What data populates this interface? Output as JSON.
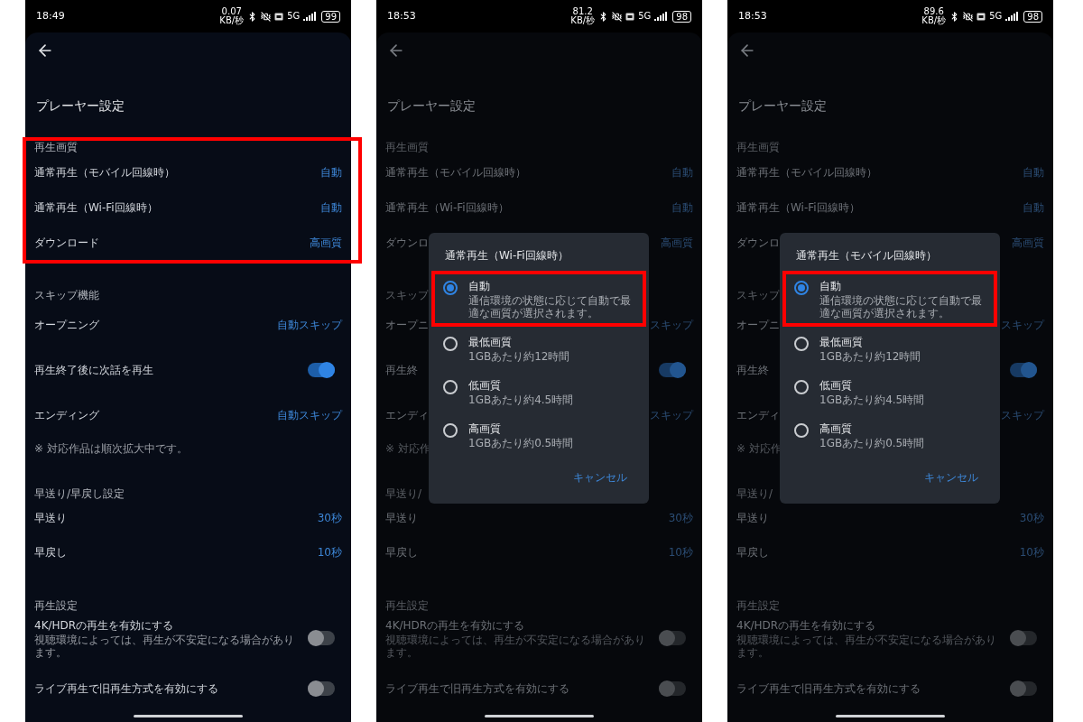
{
  "screens": [
    {
      "status_bar": {
        "time": "18:49",
        "net_speed": "0.07",
        "net_unit": "KB/秒",
        "network": "5G",
        "battery": "99"
      },
      "dimmed": false,
      "title": "プレーヤー設定",
      "sections": [
        {
          "heading": "再生画質",
          "highlight": true,
          "rows": [
            {
              "kind": "value",
              "label": "通常再生（モバイル回線時）",
              "value": "自動"
            },
            {
              "kind": "value",
              "label": "通常再生（Wi-Fi回線時）",
              "value": "自動"
            },
            {
              "kind": "value",
              "label": "ダウンロード",
              "value": "高画質"
            }
          ]
        },
        {
          "heading": "スキップ機能",
          "highlight": false,
          "rows": [
            {
              "kind": "value",
              "label": "オープニング",
              "value": "自動スキップ"
            },
            {
              "kind": "toggle",
              "label": "再生終了後に次話を再生",
              "on": true
            },
            {
              "kind": "value",
              "label": "エンディング",
              "value": "自動スキップ"
            },
            {
              "kind": "note",
              "label": "※ 対応作品は順次拡大中です。"
            }
          ]
        },
        {
          "heading": "早送り/早戻し設定",
          "highlight": false,
          "rows": [
            {
              "kind": "value",
              "label": "早送り",
              "value": "30秒"
            },
            {
              "kind": "value",
              "label": "早戻し",
              "value": "10秒"
            }
          ]
        },
        {
          "heading": "再生設定",
          "highlight": false,
          "rows": [
            {
              "kind": "toggle",
              "label": "4K/HDRの再生を有効にする",
              "sub": "視聴環境によっては、再生が不安定になる場合があります。",
              "on": false
            },
            {
              "kind": "toggle",
              "label": "ライブ再生で旧再生方式を有効にする",
              "on": false
            }
          ]
        }
      ]
    },
    {
      "status_bar": {
        "time": "18:53",
        "net_speed": "81.2",
        "net_unit": "KB/秒",
        "network": "5G",
        "battery": "98"
      },
      "dimmed": true,
      "title": "プレーヤー設定",
      "sections": [
        {
          "heading": "再生画質",
          "highlight": false,
          "rows": [
            {
              "kind": "value",
              "label": "通常再生（モバイル回線時）",
              "value": "自動"
            },
            {
              "kind": "value",
              "label": "通常再生（Wi-Fi回線時）",
              "value": "自動"
            },
            {
              "kind": "value",
              "label": "ダウンロ",
              "value": "高画質"
            }
          ]
        },
        {
          "heading": "スキップ",
          "highlight": false,
          "rows": [
            {
              "kind": "value",
              "label": "オープニ",
              "value": "スキップ"
            },
            {
              "kind": "toggle",
              "label": "再生終",
              "on": true
            },
            {
              "kind": "value",
              "label": "エンディ",
              "value": "スキップ"
            },
            {
              "kind": "note",
              "label": "※ 対応作"
            }
          ]
        },
        {
          "heading": "早送り/",
          "highlight": false,
          "rows": [
            {
              "kind": "value",
              "label": "早送り",
              "value": "30秒"
            },
            {
              "kind": "value",
              "label": "早戻し",
              "value": "10秒"
            }
          ]
        },
        {
          "heading": "再生設定",
          "highlight": false,
          "rows": [
            {
              "kind": "toggle",
              "label": "4K/HDRの再生を有効にする",
              "sub": "視聴環境によっては、再生が不安定になる場合があります。",
              "on": false
            },
            {
              "kind": "toggle",
              "label": "ライブ再生で旧再生方式を有効にする",
              "on": false
            }
          ]
        }
      ],
      "dialog": {
        "title": "通常再生（Wi-Fi回線時）",
        "cancel": "キャンセル",
        "options": [
          {
            "label": "自動",
            "sub": "通信環境の状態に応じて自動で最適な画質が選択されます。",
            "selected": true,
            "highlight": true
          },
          {
            "label": "最低画質",
            "sub": "1GBあたり約12時間",
            "selected": false,
            "highlight": false
          },
          {
            "label": "低画質",
            "sub": "1GBあたり約4.5時間",
            "selected": false,
            "highlight": false
          },
          {
            "label": "高画質",
            "sub": "1GBあたり約0.5時間",
            "selected": false,
            "highlight": false
          }
        ]
      }
    },
    {
      "status_bar": {
        "time": "18:53",
        "net_speed": "89.6",
        "net_unit": "KB/秒",
        "network": "5G",
        "battery": "98"
      },
      "dimmed": true,
      "title": "プレーヤー設定",
      "sections": [
        {
          "heading": "再生画質",
          "highlight": false,
          "rows": [
            {
              "kind": "value",
              "label": "通常再生（モバイル回線時）",
              "value": "自動"
            },
            {
              "kind": "value",
              "label": "通常再生（Wi-Fi回線時）",
              "value": "自動"
            },
            {
              "kind": "value",
              "label": "ダウンロ",
              "value": "高画質"
            }
          ]
        },
        {
          "heading": "スキップ",
          "highlight": false,
          "rows": [
            {
              "kind": "value",
              "label": "オープニ",
              "value": "スキップ"
            },
            {
              "kind": "toggle",
              "label": "再生終",
              "on": true
            },
            {
              "kind": "value",
              "label": "エンディ",
              "value": "スキップ"
            },
            {
              "kind": "note",
              "label": "※ 対応作"
            }
          ]
        },
        {
          "heading": "早送り/",
          "highlight": false,
          "rows": [
            {
              "kind": "value",
              "label": "早送り",
              "value": "30秒"
            },
            {
              "kind": "value",
              "label": "早戻し",
              "value": "10秒"
            }
          ]
        },
        {
          "heading": "再生設定",
          "highlight": false,
          "rows": [
            {
              "kind": "toggle",
              "label": "4K/HDRの再生を有効にする",
              "sub": "視聴環境によっては、再生が不安定になる場合があります。",
              "on": false
            },
            {
              "kind": "toggle",
              "label": "ライブ再生で旧再生方式を有効にする",
              "on": false
            }
          ]
        }
      ],
      "dialog": {
        "title": "通常再生（モバイル回線時）",
        "cancel": "キャンセル",
        "options": [
          {
            "label": "自動",
            "sub": "通信環境の状態に応じて自動で最適な画質が選択されます。",
            "selected": true,
            "highlight": true
          },
          {
            "label": "最低画質",
            "sub": "1GBあたり約12時間",
            "selected": false,
            "highlight": false
          },
          {
            "label": "低画質",
            "sub": "1GBあたり約4.5時間",
            "selected": false,
            "highlight": false
          },
          {
            "label": "高画質",
            "sub": "1GBあたり約0.5時間",
            "selected": false,
            "highlight": false
          }
        ]
      }
    }
  ]
}
